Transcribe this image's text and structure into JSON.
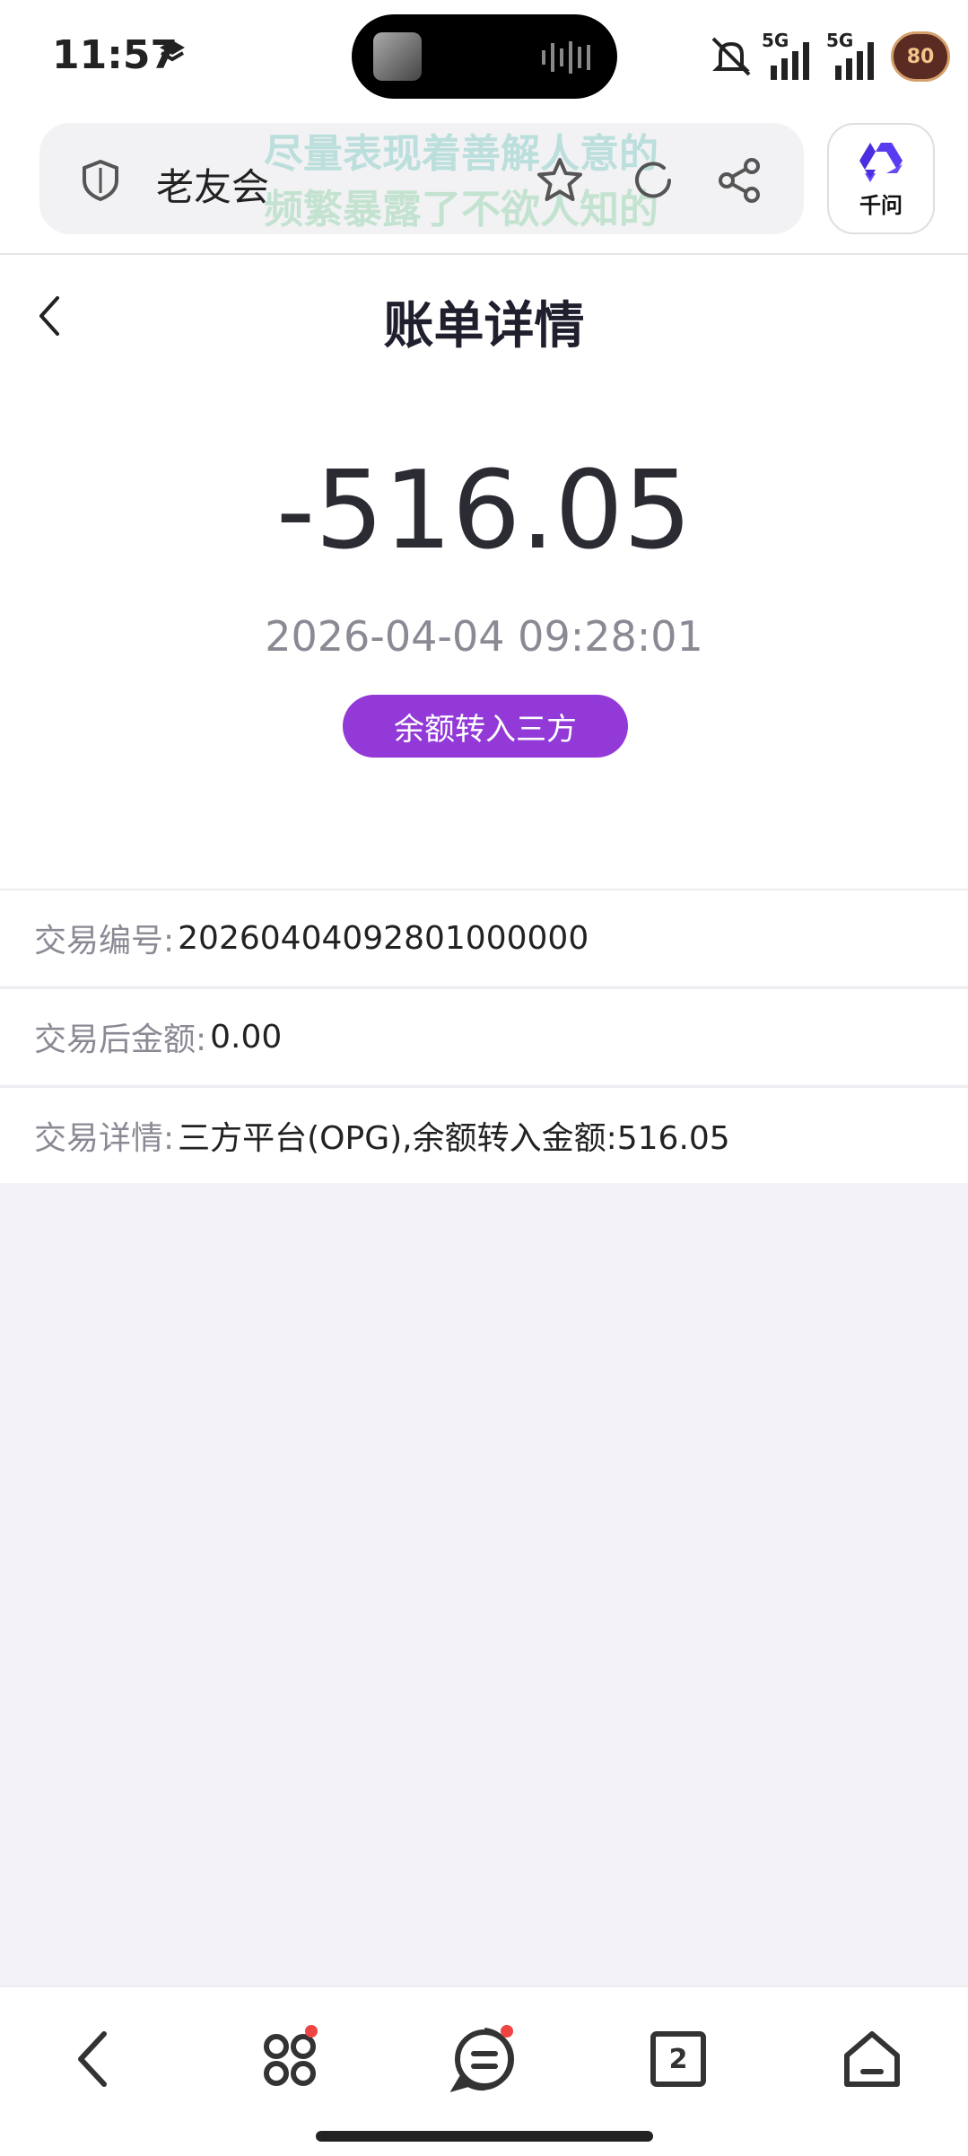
{
  "status_bar": {
    "time": "11:57",
    "network1": "5G",
    "network2": "5G",
    "battery": "80"
  },
  "browser": {
    "site_name": "老友会",
    "watermark_line1": "尽量表现着善解人意的",
    "watermark_line2": "频繁暴露了不欲人知的",
    "assistant_label": "千问"
  },
  "page": {
    "title": "账单详情"
  },
  "bill": {
    "amount": "-516.05",
    "datetime": "2026-04-04 09:28:01",
    "type_tag": "余额转入三方",
    "tag_color": "#9339d8"
  },
  "details": [
    {
      "label": "交易编号:",
      "value": "20260404092801000000"
    },
    {
      "label": "交易后金额:",
      "value": "0.00"
    },
    {
      "label": "交易详情:",
      "value": "三方平台(OPG),余额转入金额:516.05"
    }
  ],
  "bottom_nav": {
    "tab_count": "2",
    "icons": [
      "back-icon",
      "apps-icon",
      "menu-icon",
      "tabs-icon",
      "home-icon"
    ]
  }
}
